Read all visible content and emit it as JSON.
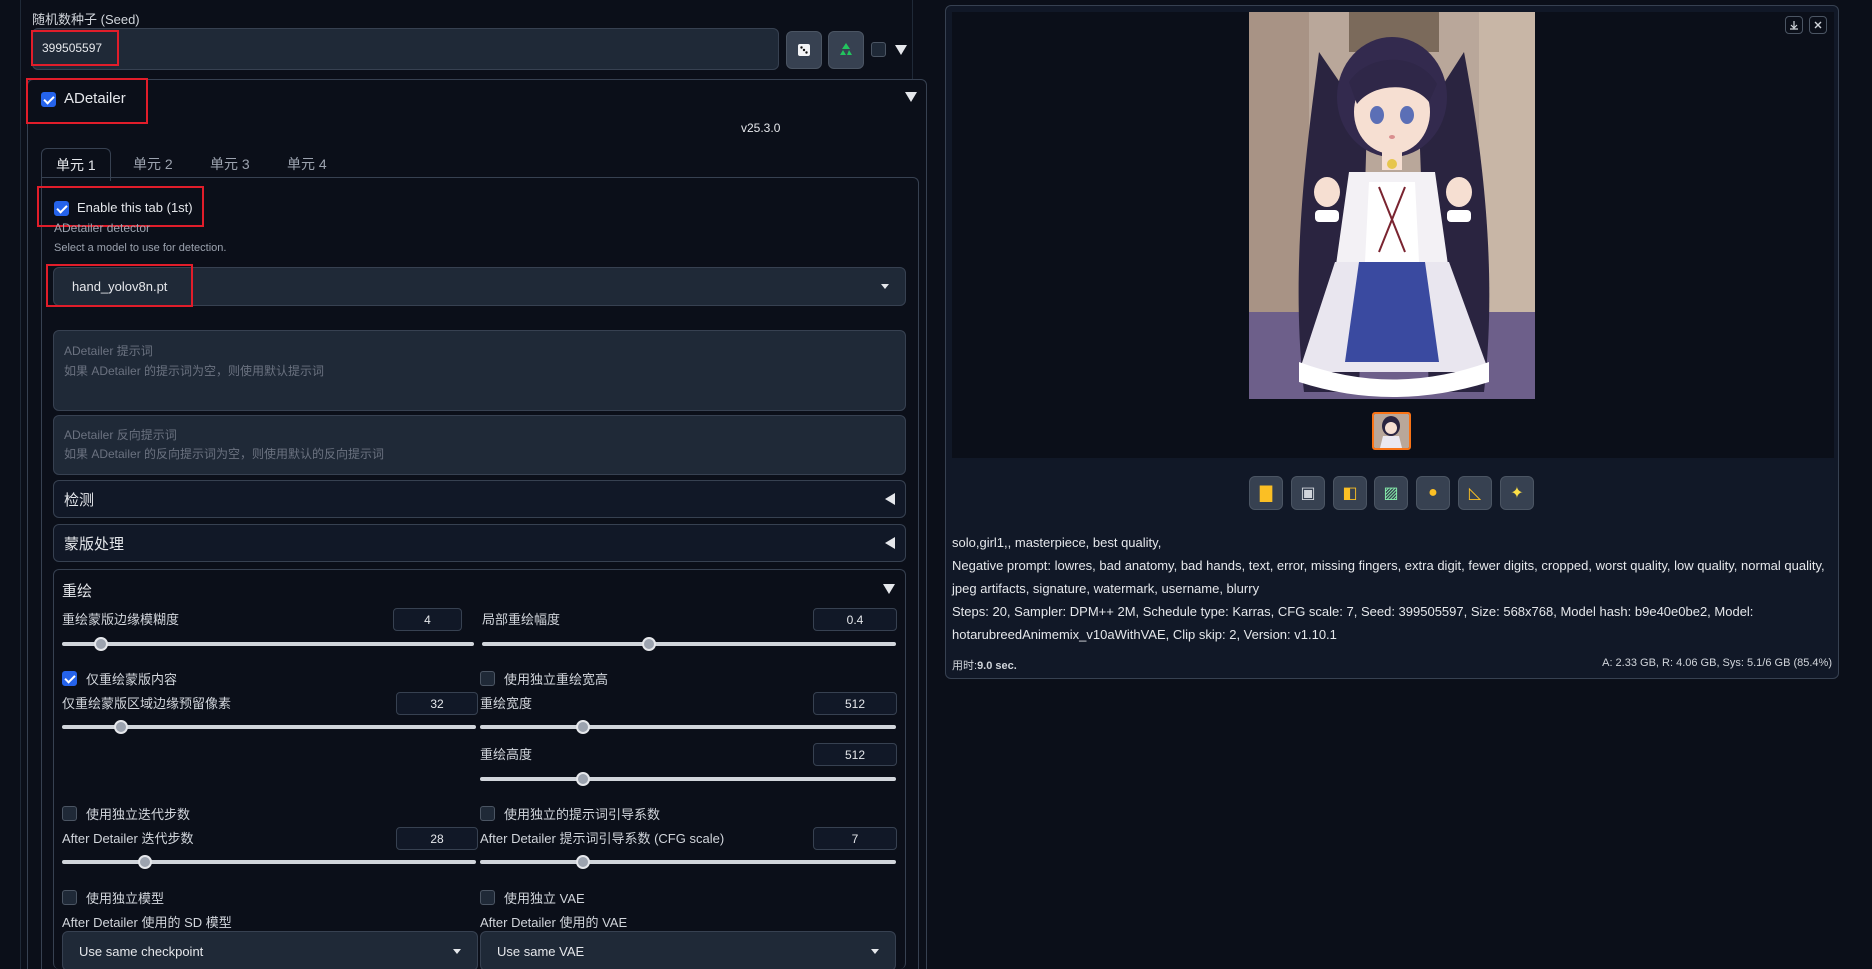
{
  "seed": {
    "label": "随机数种子 (Seed)",
    "value": "399505597"
  },
  "adetailer": {
    "title": "ADetailer",
    "version": "v25.3.0",
    "tabs": [
      "单元 1",
      "单元 2",
      "单元 3",
      "单元 4"
    ],
    "enable_label": "Enable this tab (1st)",
    "detector_label": "ADetailer detector",
    "detector_hint": "Select a model to use for detection.",
    "detector_value": "hand_yolov8n.pt",
    "prompt_label": "ADetailer 提示词",
    "prompt_placeholder": "如果 ADetailer 的提示词为空，则使用默认提示词",
    "neg_prompt_label": "ADetailer 反向提示词",
    "neg_prompt_placeholder": "如果 ADetailer 的反向提示词为空，则使用默认的反向提示词",
    "sections": {
      "detect": "检测",
      "mask": "蒙版处理",
      "inpaint": "重绘"
    },
    "inpaint": {
      "mask_blur_label": "重绘蒙版边缘模糊度",
      "mask_blur_value": "4",
      "mask_blur_frac": 0.08,
      "denoise_label": "局部重绘幅度",
      "denoise_value": "0.4",
      "denoise_frac": 0.4,
      "only_masked_label": "仅重绘蒙版内容",
      "padding_label": "仅重绘蒙版区域边缘预留像素",
      "padding_value": "32",
      "padding_frac": 0.13,
      "use_sep_wh_label": "使用独立重绘宽高",
      "width_label": "重绘宽度",
      "width_value": "512",
      "width_frac": 0.24,
      "height_label": "重绘高度",
      "height_value": "512",
      "height_frac": 0.24,
      "sep_steps_label": "使用独立迭代步数",
      "steps_label": "After Detailer 迭代步数",
      "steps_value": "28",
      "steps_frac": 0.19,
      "sep_cfg_label": "使用独立的提示词引导系数",
      "cfg_label": "After Detailer 提示词引导系数 (CFG scale)",
      "cfg_value": "7",
      "cfg_frac": 0.24,
      "sep_model_label": "使用独立模型",
      "sep_vae_label": "使用独立 VAE",
      "model_label": "After Detailer 使用的 SD 模型",
      "model_value": "Use same checkpoint",
      "vae_label": "After Detailer 使用的 VAE",
      "vae_value": "Use same VAE"
    }
  },
  "output": {
    "prompt": "solo,girl1,, masterpiece, best quality,",
    "negative": "Negative prompt: lowres, bad anatomy, bad hands, text, error, missing fingers, extra digit, fewer digits, cropped, worst quality, low quality, normal quality, jpeg artifacts, signature, watermark, username, blurry",
    "params": "Steps: 20, Sampler: DPM++ 2M, Schedule type: Karras, CFG scale: 7, Seed: 399505597, Size: 568x768, Model hash: b9e40e0be2, Model: hotarubreedAnimemix_v10aWithVAE, Clip skip: 2, Version: v1.10.1",
    "time_label": "用时:",
    "time_value": "9.0 sec.",
    "mem": "A: 2.33 GB, R: 4.06 GB, Sys: 5.1/6 GB (85.4%)",
    "tools": [
      "folder-icon",
      "save-icon",
      "zip-icon",
      "image-icon",
      "palette-icon",
      "ruler-icon",
      "sparkle-icon"
    ]
  }
}
